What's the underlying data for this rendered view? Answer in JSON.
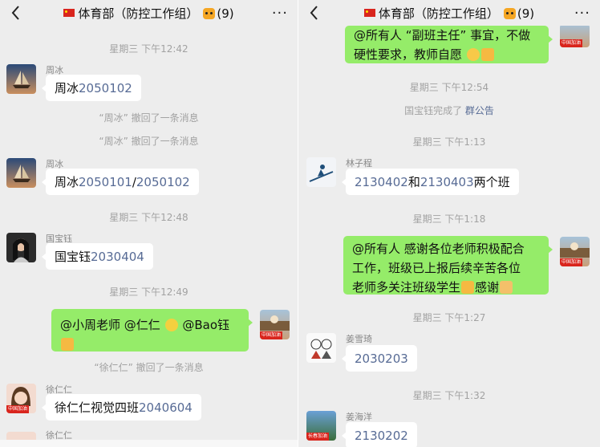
{
  "left": {
    "title": "体育部（防控工作组）",
    "member_count": "(9)",
    "more": "···",
    "time1": "星期三 下午12:42",
    "msg1": {
      "sender": "周冰",
      "name": "周冰",
      "num": "2050102"
    },
    "recall1": "“周冰” 撤回了一条消息",
    "recall2": "“周冰” 撤回了一条消息",
    "msg2": {
      "sender": "周冰",
      "name": "周冰",
      "num1": "2050101",
      "sep": "/",
      "num2": "2050102"
    },
    "time2": "星期三 下午12:48",
    "msg3": {
      "sender": "国宝钰",
      "name": "国宝钰",
      "num": "2030404"
    },
    "time3": "星期三 下午12:49",
    "msg4": {
      "mention1": "@小周老师 @仁仁",
      "mention2": " @Bao钰",
      "avatar_badge": "中国加油"
    },
    "recall3": "“徐仁仁” 撤回了一条消息",
    "msg5": {
      "sender": "徐仁仁",
      "text": "徐仁仁视觉四班",
      "num": "2040604",
      "avatar_badge": "中国加油"
    },
    "msg6": {
      "sender": "徐仁仁"
    }
  },
  "right": {
    "title": "体育部（防控工作组）",
    "member_count": "(9)",
    "more": "···",
    "msg0": {
      "line1": "@所有人 “副班主任” 事宜，不做",
      "line2": "硬性要求，教师自愿",
      "avatar_badge": "中国加油"
    },
    "time1": "星期三 下午12:54",
    "notice_prefix": "国宝钰完成了 ",
    "notice_link": "群公告",
    "time2": "星期三 下午1:13",
    "msg1": {
      "sender": "林子程",
      "num1": "2130402",
      "mid": "和",
      "num2": "2130403",
      "tail": "两个班"
    },
    "time3": "星期三 下午1:18",
    "msg2": {
      "line1": "@所有人 感谢各位老师积极配合",
      "line2": "工作，班级已上报后续辛苦各位",
      "line3": "老师多关注班级学生",
      "thanks": "感谢",
      "avatar_badge": "中国加油"
    },
    "time4": "星期三 下午1:27",
    "msg3": {
      "sender": "姜雪琦",
      "num": "2030203"
    },
    "time5": "星期三 下午1:32",
    "msg4": {
      "sender": "姜海洋",
      "num": "2130202",
      "avatar_badge": "长春加油"
    }
  },
  "colors": {
    "bg": "#ededed",
    "bubble_in": "#ffffff",
    "bubble_out": "#95ec69",
    "link": "#576b95",
    "system": "#a2a2a2"
  },
  "icons": [
    "back-chevron-icon",
    "flag-icon",
    "tiger-icon",
    "more-icon",
    "smile-emoji-icon",
    "thumbs-up-emoji-icon",
    "lemon-emoji-icon",
    "pray-emoji-icon"
  ]
}
